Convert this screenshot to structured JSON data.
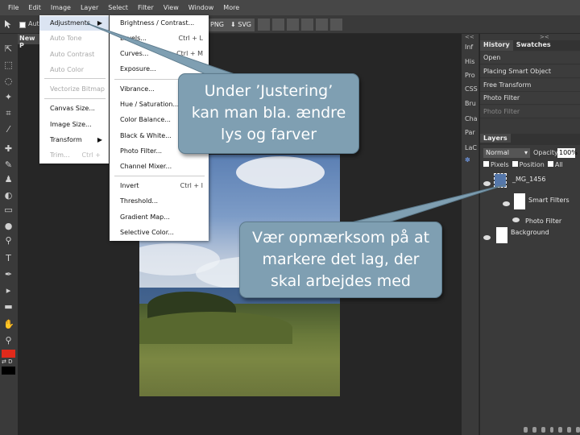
{
  "menubar": [
    "File",
    "Edit",
    "Image",
    "Layer",
    "Select",
    "Filter",
    "View",
    "Window",
    "More"
  ],
  "options": {
    "auto_label": "Auto",
    "png_label": "PNG",
    "svg_label": "SVG"
  },
  "document_tab": "New P",
  "image_menu": {
    "items": [
      {
        "label": "Adjustments",
        "disabled": false,
        "submenu": true
      },
      {
        "label": "Auto Tone",
        "disabled": true
      },
      {
        "label": "Auto Contrast",
        "disabled": true
      },
      {
        "label": "Auto Color",
        "disabled": true
      },
      {
        "label": "Vectorize Bitmap",
        "disabled": true
      },
      {
        "label": "Canvas Size...",
        "disabled": false
      },
      {
        "label": "Image Size...",
        "disabled": false
      },
      {
        "label": "Transform",
        "disabled": false,
        "submenu": true
      },
      {
        "label": "Trim...",
        "disabled": true,
        "shortcut": "Ctrl +"
      }
    ]
  },
  "adjustments_menu": {
    "items": [
      {
        "label": "Brightness / Contrast...",
        "shortcut": ""
      },
      {
        "label": "Levels...",
        "shortcut": "Ctrl + L"
      },
      {
        "label": "Curves...",
        "shortcut": "Ctrl + M"
      },
      {
        "label": "Exposure...",
        "shortcut": ""
      },
      {
        "label": "Vibrance...",
        "shortcut": ""
      },
      {
        "label": "Hue / Saturation...",
        "shortcut": ""
      },
      {
        "label": "Color Balance...",
        "shortcut": ""
      },
      {
        "label": "Black & White...",
        "shortcut": ""
      },
      {
        "label": "Photo Filter...",
        "shortcut": ""
      },
      {
        "label": "Channel Mixer...",
        "shortcut": ""
      },
      {
        "label": "Invert",
        "shortcut": "Ctrl + I"
      },
      {
        "label": "Threshold...",
        "shortcut": ""
      },
      {
        "label": "Gradient Map...",
        "shortcut": ""
      },
      {
        "label": "Selective Color...",
        "shortcut": ""
      }
    ]
  },
  "right_strip": [
    "Inf",
    "His",
    "Pro",
    "CSS",
    "Bru",
    "Cha",
    "Par",
    "LaC"
  ],
  "history_panel": {
    "tabs": [
      "History",
      "Swatches"
    ],
    "items": [
      "Open",
      "Placing Smart Object",
      "Free Transform",
      "Photo Filter",
      "Photo Filter"
    ]
  },
  "layers_panel": {
    "title": "Layers",
    "blend_mode": "Normal",
    "opacity_label": "Opacity:",
    "opacity_value": "100%",
    "lock_labels": [
      "Pixels",
      "Position",
      "All"
    ],
    "layers": [
      {
        "name": "_MG_1456"
      },
      {
        "name": "Smart Filters"
      },
      {
        "name": "Photo Filter"
      },
      {
        "name": "Background"
      }
    ]
  },
  "callouts": {
    "top": [
      "Under ’Justering’",
      "kan man bla. ændre",
      "lys og farver"
    ],
    "bottom": [
      "Vær opmærksom på at",
      "markere det lag, der",
      "skal arbejdes med"
    ]
  },
  "colors": {
    "foreground": "#e02a1b",
    "background": "#000000",
    "callout": "#7f9fb2",
    "highlight": "#dbe4f2"
  }
}
